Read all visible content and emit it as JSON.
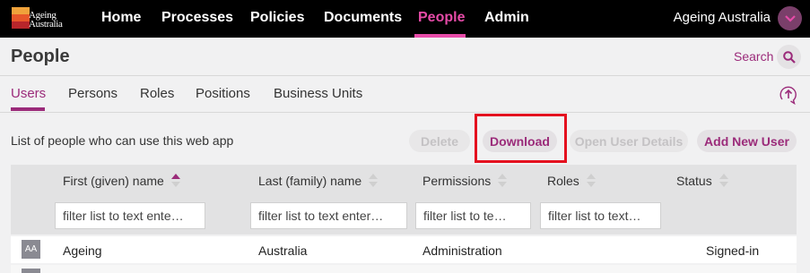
{
  "brand": {
    "logo_text_line1": "Ageing",
    "logo_text_line2": "Australia"
  },
  "nav": {
    "items": [
      {
        "label": "Home"
      },
      {
        "label": "Processes"
      },
      {
        "label": "Policies"
      },
      {
        "label": "Documents"
      },
      {
        "label": "People",
        "active": true
      },
      {
        "label": "Admin"
      }
    ],
    "org_name": "Ageing Australia",
    "accent_color": "#e64ba8"
  },
  "header": {
    "title": "People",
    "search_label": "Search"
  },
  "tabs": [
    {
      "label": "Users",
      "active": true
    },
    {
      "label": "Persons"
    },
    {
      "label": "Roles"
    },
    {
      "label": "Positions"
    },
    {
      "label": "Business Units"
    }
  ],
  "toolbar": {
    "description": "List of people who can use this web app",
    "delete_label": "Delete",
    "download_label": "Download",
    "open_details_label": "Open User Details",
    "add_user_label": "Add New User"
  },
  "table": {
    "columns": [
      {
        "label": "First (given) name",
        "sort": "ascending"
      },
      {
        "label": "Last (family) name",
        "sort": "none"
      },
      {
        "label": "Permissions",
        "sort": "none"
      },
      {
        "label": "Roles",
        "sort": "none"
      },
      {
        "label": "Status",
        "sort": "none"
      }
    ],
    "filter_placeholders": [
      "filter list to text ente…",
      "filter list to text enter…",
      "filter list to te…",
      "filter list to text…"
    ],
    "rows": [
      {
        "initials": "AA",
        "first": "Ageing",
        "last": "Australia",
        "permissions": "Administration",
        "roles": "",
        "status": "Signed-in"
      }
    ]
  },
  "colors": {
    "brand_purple": "#9b2b7a",
    "highlight_red": "#e4101f"
  }
}
